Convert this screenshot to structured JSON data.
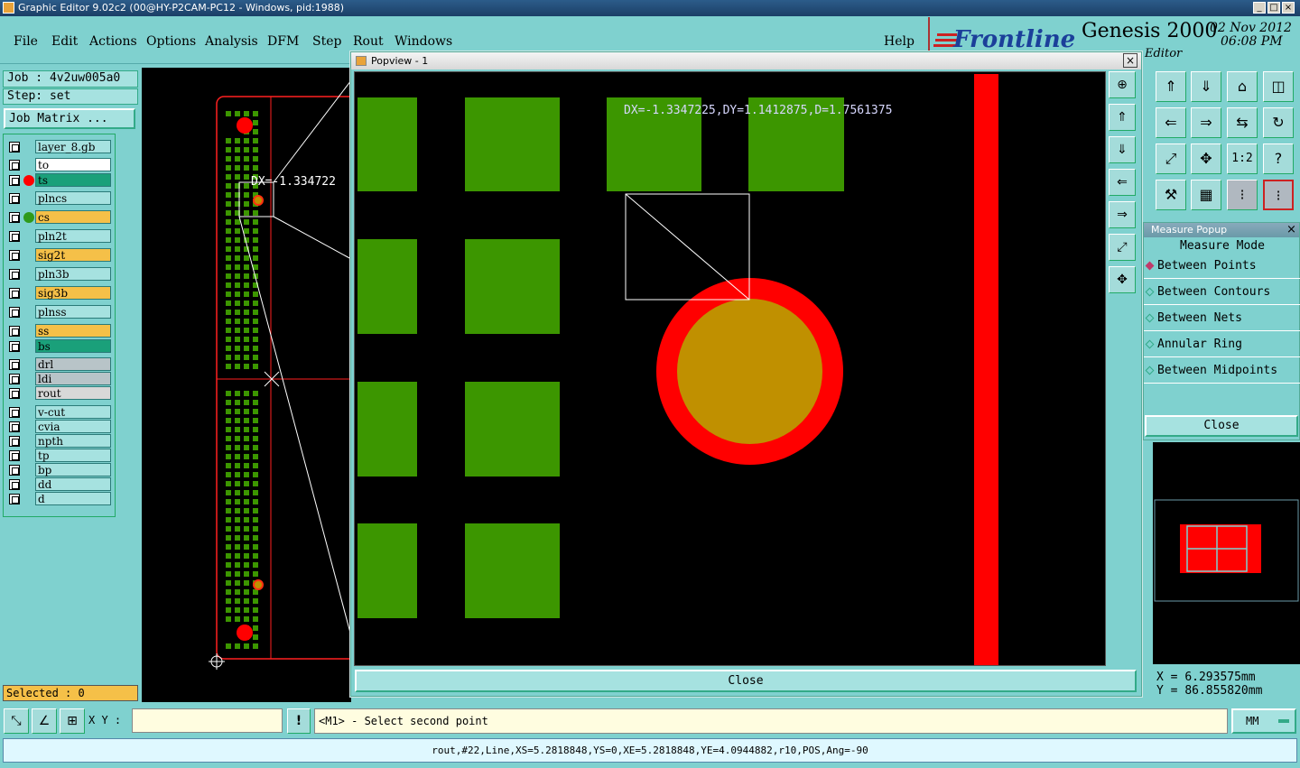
{
  "window": {
    "title": "Graphic Editor 9.02c2 (00@HY-P2CAM-PC12 - Windows, pid:1988)",
    "min": "_",
    "max": "□",
    "close": "×"
  },
  "menu": [
    "File",
    "Edit",
    "Actions",
    "Options",
    "Analysis",
    "DFM",
    "Step",
    "Rout",
    "Windows"
  ],
  "help": "Help",
  "brand": {
    "logo": "Frontline",
    "product": "Genesis 2000",
    "date": "02 Nov 2012",
    "time": "06:08 PM",
    "sub": "Editor"
  },
  "job": {
    "job_label": "Job :",
    "job_value": "4v2uw005a0",
    "step_label": "Step:",
    "step_value": "set",
    "matrix_button": "Job Matrix ..."
  },
  "layers": [
    {
      "name": "layer_8.gb",
      "color": "#a6e2e0"
    },
    {
      "name": "to",
      "color": "#ffffff"
    },
    {
      "name": "ts",
      "color": "#1aa07a"
    },
    {
      "name": "plncs",
      "color": "#a6e2e0"
    },
    {
      "name": "cs",
      "color": "#f5c048"
    },
    {
      "name": "pln2t",
      "color": "#a6e2e0"
    },
    {
      "name": "sig2t",
      "color": "#f5c048"
    },
    {
      "name": "pln3b",
      "color": "#a6e2e0"
    },
    {
      "name": "sig3b",
      "color": "#f5c048"
    },
    {
      "name": "plnss",
      "color": "#a6e2e0"
    },
    {
      "name": "ss",
      "color": "#f5c048"
    },
    {
      "name": "bs",
      "color": "#1aa07a"
    },
    {
      "name": "drl",
      "color": "#b8c4c8"
    },
    {
      "name": "ldi",
      "color": "#b8c4c8"
    },
    {
      "name": "rout",
      "color": "#d8d8d8"
    },
    {
      "name": "v-cut",
      "color": "#a6e2e0"
    },
    {
      "name": "cvia",
      "color": "#a6e2e0"
    },
    {
      "name": "npth",
      "color": "#a6e2e0"
    },
    {
      "name": "tp",
      "color": "#a6e2e0"
    },
    {
      "name": "bp",
      "color": "#a6e2e0"
    },
    {
      "name": "dd",
      "color": "#a6e2e0"
    },
    {
      "name": "d",
      "color": "#a6e2e0"
    }
  ],
  "selected": "Selected : 0",
  "canvas": {
    "measure_text": "DX=-1.334722"
  },
  "popview": {
    "title": "Popview - 1",
    "close": "Close",
    "close_x": "×",
    "measure_text": "DX=-1.3347225,DY=1.1412875,D=1.7561375"
  },
  "measure_popup": {
    "title": "Measure Popup",
    "heading": "Measure Mode",
    "modes": [
      "Between Points",
      "Between Contours",
      "Between Nets",
      "Annular Ring",
      "Between Midpoints"
    ],
    "close": "Close",
    "close_x": "×"
  },
  "coords": {
    "x_label": "X =",
    "x_value": "6.293575mm",
    "y_label": "Y =",
    "y_value": "86.855820mm"
  },
  "bottom": {
    "xy_label": "X Y :",
    "xy_value": "",
    "info_icon": "!",
    "prompt": "<M1> - Select second point",
    "units": "MM",
    "status": "rout,#22,Line,XS=5.2818848,YS=0,XE=5.2818848,YE=4.0944882,r10,POS,Ang=-90"
  },
  "colors": {
    "pad_green": "#3c9600",
    "red": "#ff0000",
    "copper": "#c09000",
    "bg_teal": "#7fd1cf"
  }
}
